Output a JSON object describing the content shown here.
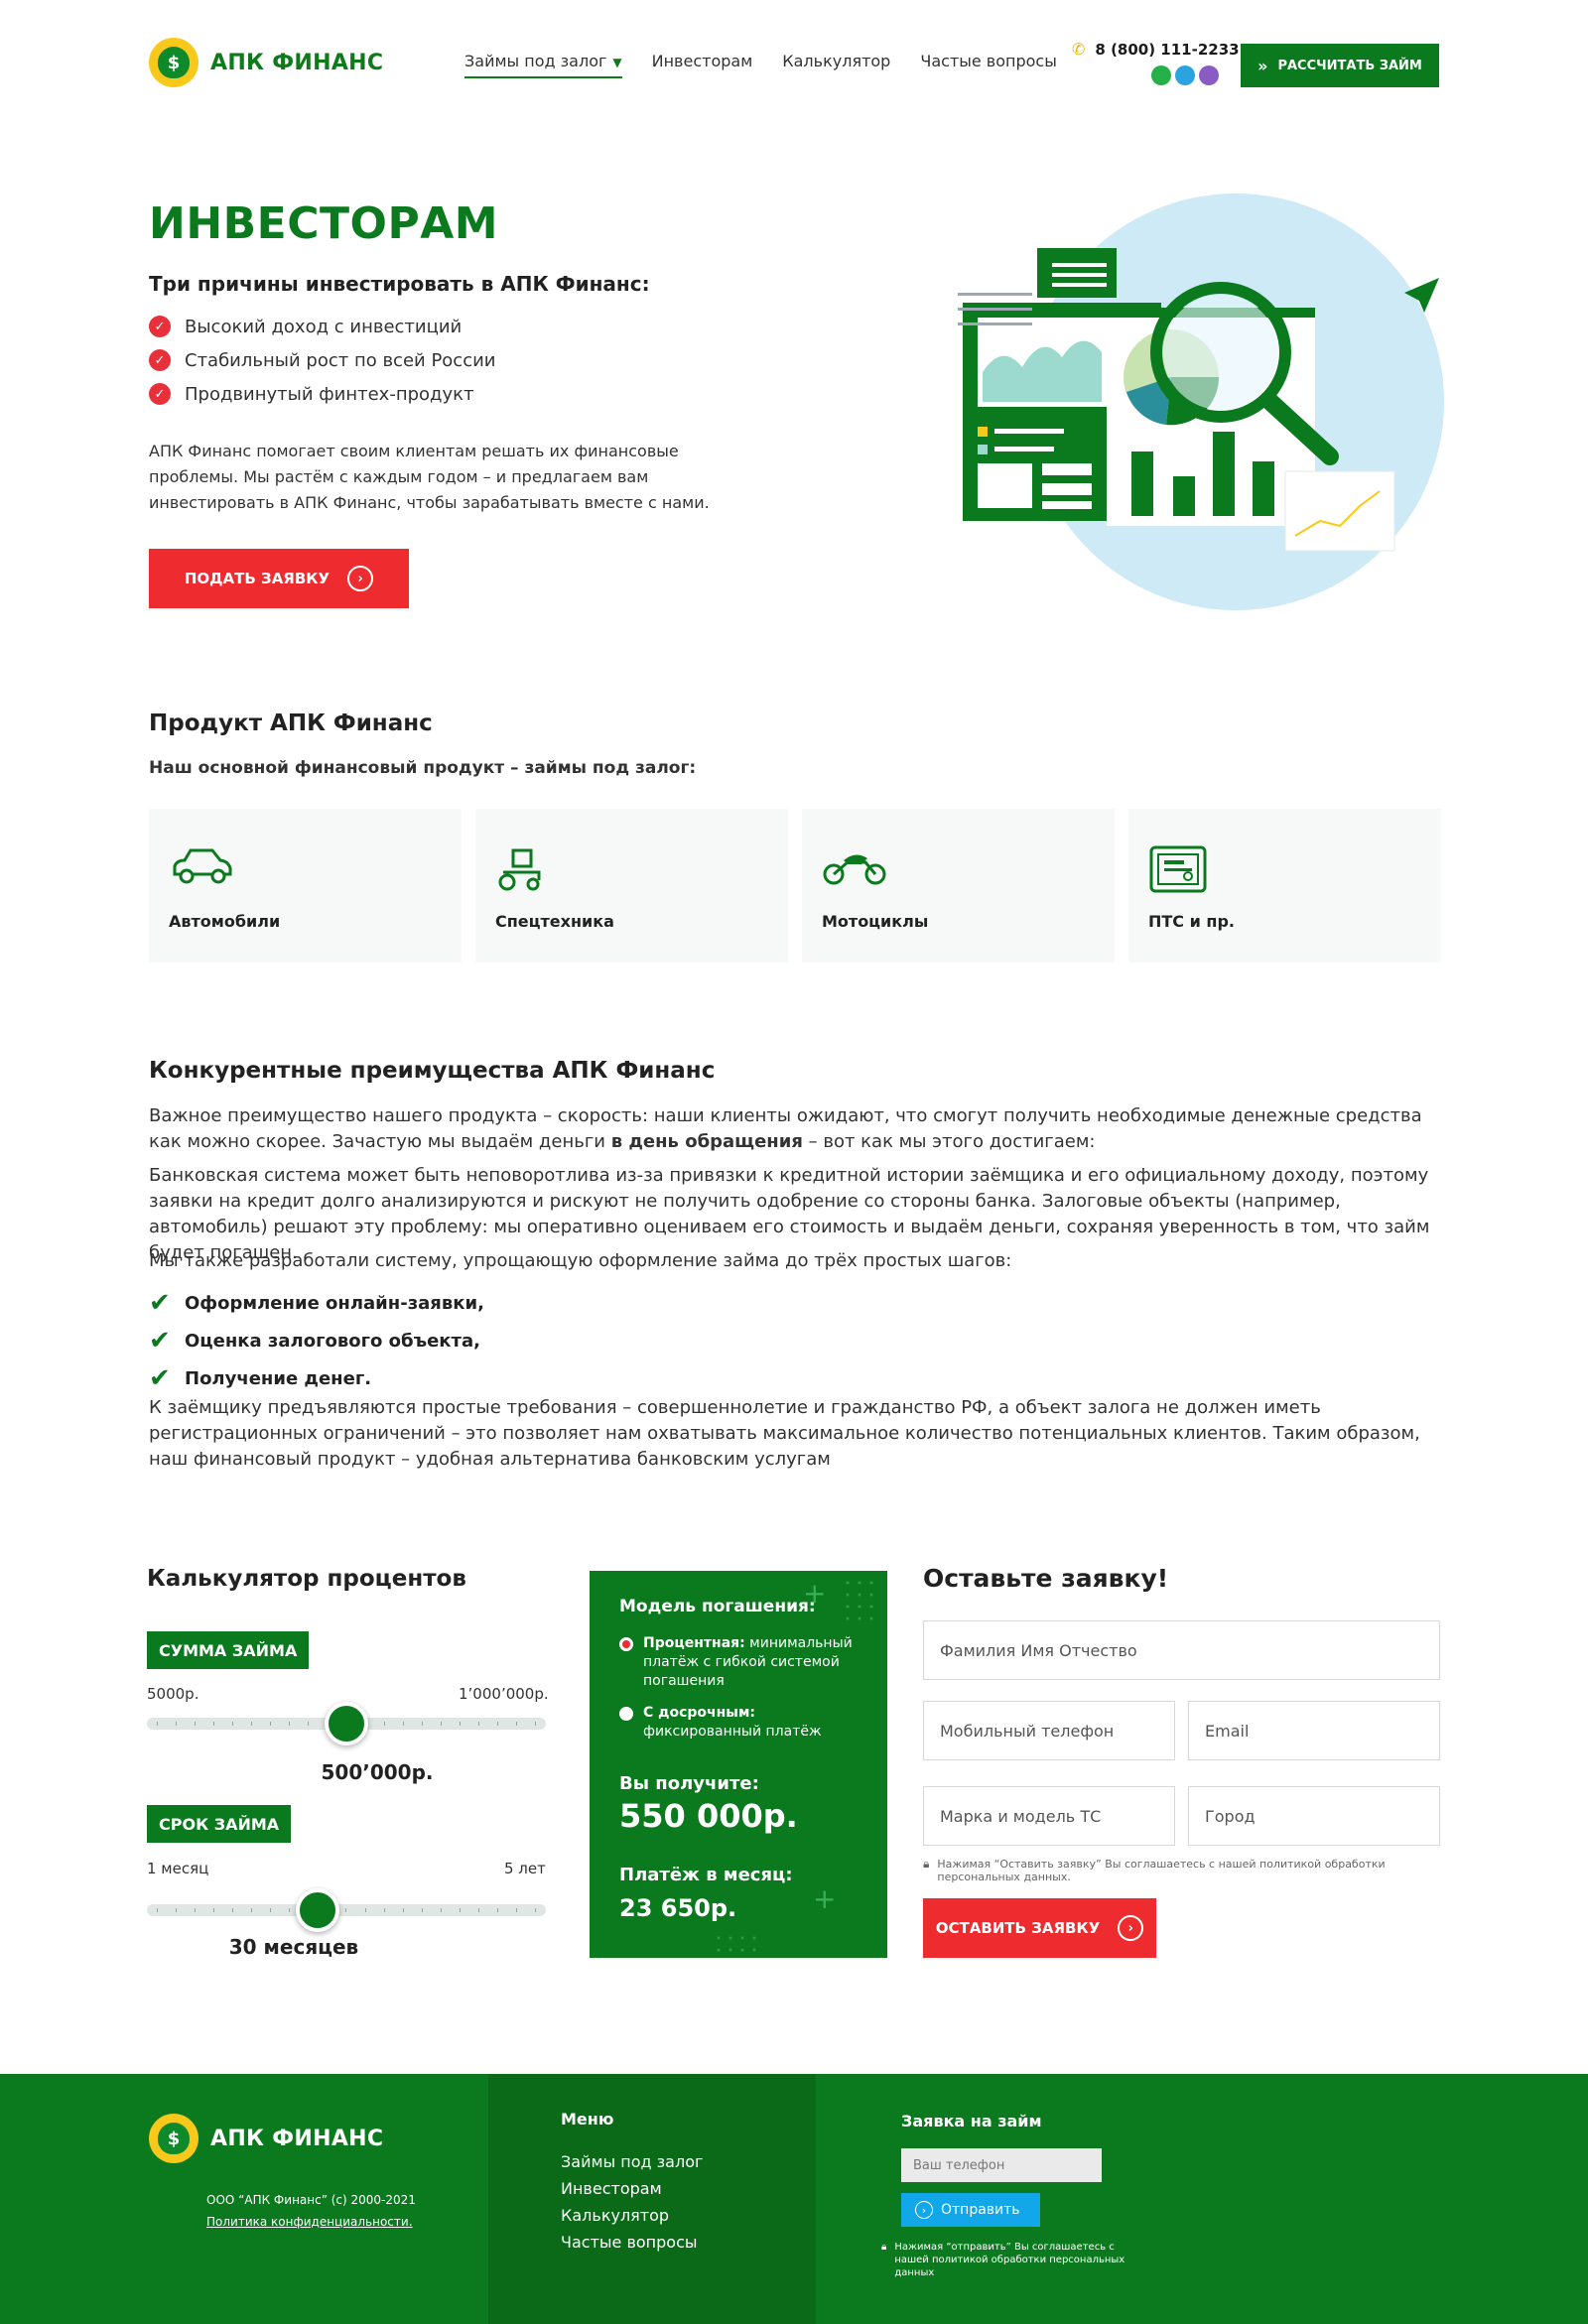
{
  "header": {
    "logo_text": "АПК ФИНАНС",
    "nav": [
      {
        "label": "Займы под залог",
        "active": true
      },
      {
        "label": "Инвесторам",
        "active": false
      },
      {
        "label": "Калькулятор",
        "active": false
      },
      {
        "label": "Частые вопросы",
        "active": false
      }
    ],
    "phone": "8 (800) 111-2233",
    "messengers": [
      "whatsapp-icon",
      "telegram-icon",
      "viber-icon"
    ],
    "cta": "РАССЧИТАТЬ ЗАЙМ"
  },
  "hero": {
    "title": "ИНВЕСТОРАМ",
    "subtitle": "Три причины инвестировать в АПК Финанс:",
    "reasons": [
      "Высокий доход с инвестиций",
      "Стабильный рост по всей России",
      "Продвинутый финтех-продукт"
    ],
    "description": "АПК Финанс помогает своим клиентам решать их финансовые проблемы. Мы растём с каждым годом – и предлагаем вам инвестировать в АПК Финанс, чтобы зарабатывать вместе с нами.",
    "button": "ПОДАТЬ ЗАЯВКУ"
  },
  "product": {
    "title": "Продукт АПК Финанс",
    "lead": "Наш основной финансовый продукт – займы под залог:",
    "cards": [
      {
        "label": "Автомобили",
        "icon": "car-icon"
      },
      {
        "label": "Спецтехника",
        "icon": "tractor-icon"
      },
      {
        "label": "Мотоциклы",
        "icon": "motorcycle-icon"
      },
      {
        "label": "ПТС и пр.",
        "icon": "document-icon"
      }
    ]
  },
  "advantages": {
    "title": "Конкурентные преимущества АПК Финанс",
    "p1_start": "Важное преимущество нашего продукта – скорость: наши клиенты ожидают, что смогут получить необходимые денежные средства как можно скорее. Зачастую мы выдаём деньги ",
    "p1_bold": "в день обращения",
    "p1_end": " – вот как мы этого достигаем:",
    "p2": "Банковская система может быть неповоротлива из-за привязки к кредитной истории заёмщика и его официальному доходу, поэтому заявки на кредит долго анализируются и рискуют не получить одобрение со стороны банка. Залоговые объекты (например, автомобиль) решают эту проблему: мы оперативно оцениваем его стоимость и выдаём деньги, сохраняя уверенность в том, что займ будет погашен.",
    "p3": "Мы также разработали систему, упрощающую оформление займа до трёх простых шагов:",
    "steps": [
      "Оформление онлайн-заявки,",
      "Оценка залогового объекта,",
      "Получение денег."
    ],
    "p4": "К заёмщику предъявляются простые требования – совершеннолетие и гражданство РФ, а объект залога не должен иметь регистрационных ограничений – это позволяет нам охватывать максимальное количество потенциальных клиентов. Таким образом, наш финансовый продукт – удобная альтернатива банковским услугам"
  },
  "calculator": {
    "title": "Калькулятор процентов",
    "amount": {
      "label": "СУММА ЗАЙМА",
      "min": "5000р.",
      "max": "1’000’000р.",
      "value": "500’000р.",
      "level": 0.5
    },
    "term": {
      "label": "СРОК ЗАЙМА",
      "min": "1 месяц",
      "max": "5 лет",
      "value": "30 месяцев",
      "level": 0.42
    },
    "model_title": "Модель погашения:",
    "options": [
      {
        "bold": "Процентная:",
        "text": " минимальный платёж с гибкой системой погашения",
        "selected": true
      },
      {
        "bold": "С досрочным:",
        "text": " фиксированный платёж",
        "selected": false
      }
    ],
    "receive_label": "Вы получите:",
    "receive_value": "550 000р.",
    "payment_label": "Платёж в месяц:",
    "payment_value": "23 650р."
  },
  "form": {
    "title": "Оставьте заявку!",
    "fio": "Фамилия Имя Отчество",
    "phone": "Мобильный телефон",
    "email": "Email",
    "car": "Марка и модель ТС",
    "city": "Город",
    "consent": "Нажимая “Оставить заявку” Вы соглашаетесь с нашей политикой обработки персональных данных.",
    "button": "ОСТАВИТЬ ЗАЯВКУ"
  },
  "footer": {
    "logo_text": "АПК ФИНАНС",
    "copyright": "ООО “АПК Финанс” (с) 2000-2021",
    "privacy": "Политика конфиденциальности.",
    "menu_title": "Меню",
    "menu": [
      "Займы под залог",
      "Инвесторам",
      "Калькулятор",
      "Частые вопросы"
    ],
    "request_title": "Заявка на займ",
    "phone_placeholder": "Ваш телефон",
    "send": "Отправить",
    "consent": "Нажимая “отправить” Вы соглашаетесь с нашей политикой обработки персональных данных"
  },
  "colors": {
    "brand_green": "#0b7a1e",
    "accent_red": "#ee2b2f",
    "coin_yellow": "#f8c81a",
    "light_blue": "#cdeaf6"
  }
}
